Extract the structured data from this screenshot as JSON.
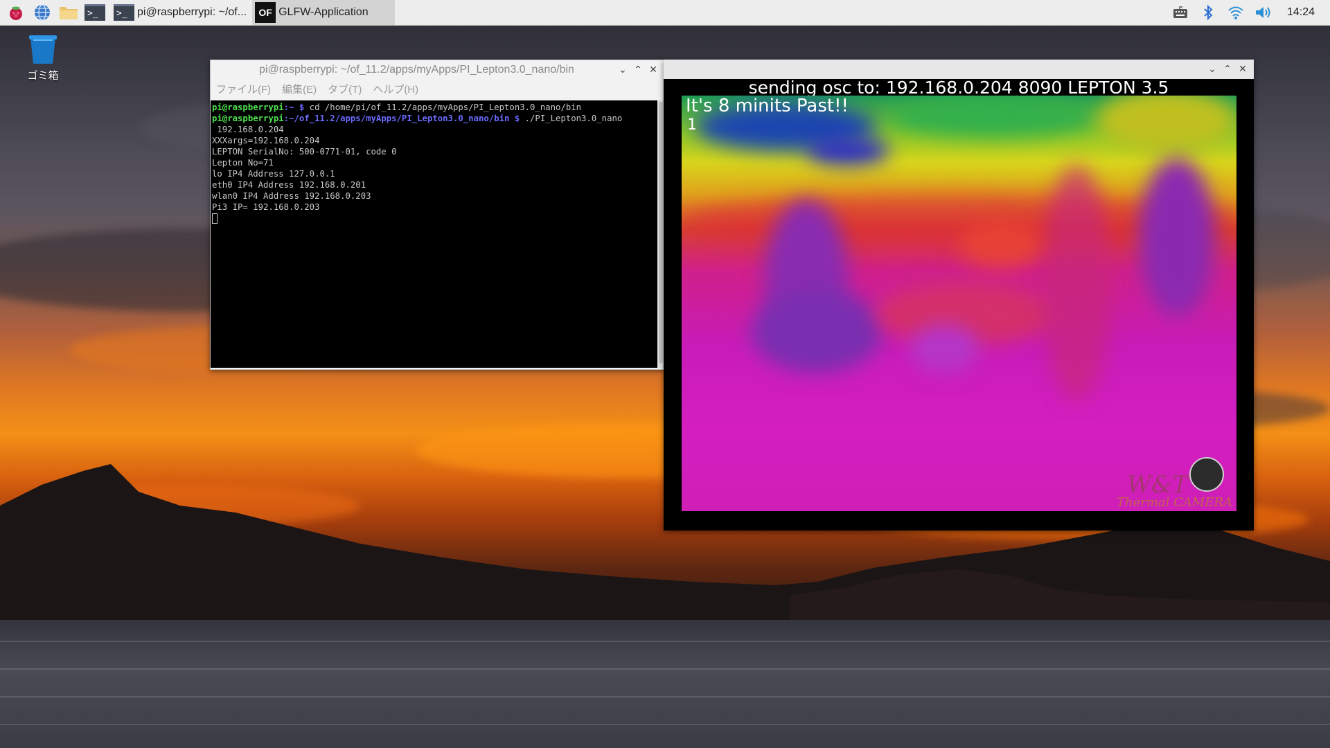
{
  "taskbar": {
    "launchers": [
      "raspberry-menu-icon",
      "web-browser-icon",
      "file-manager-icon",
      "terminal-icon"
    ],
    "tasks": [
      {
        "label": "pi@raspberrypi: ~/of..."
      },
      {
        "label": "GLFW-Application"
      }
    ],
    "of_logo": "OF",
    "clock": "14:24"
  },
  "desktop": {
    "trash_label": "ゴミ箱"
  },
  "terminal": {
    "title": "pi@raspberrypi: ~/of_11.2/apps/myApps/PI_Lepton3.0_nano/bin",
    "menus": [
      "ファイル(F)",
      "編集(E)",
      "タブ(T)",
      "ヘルプ(H)"
    ],
    "prompt_user": "pi@raspberrypi",
    "line1_path": ":~ $",
    "line1_cmd": " cd /home/pi/of_11.2/apps/myApps/PI_Lepton3.0_nano/bin",
    "line2_path": ":~/of_11.2/apps/myApps/PI_Lepton3.0_nano/bin $",
    "line2_cmd": " ./PI_Lepton3.0_nano",
    "output": [
      " 192.168.0.204",
      "XXXargs=192.168.0.204",
      "LEPTON SerialNo: 500-0771-01, code 0",
      "Lepton No=71",
      "lo IP4 Address 127.0.0.1",
      "eth0 IP4 Address 192.168.0.201",
      "wlan0 IP4 Address 192.168.0.203",
      "Pi3 IP= 192.168.0.203"
    ]
  },
  "glfw": {
    "osc_status": "sending osc to: 192.168.0.204 8090 LEPTON 3.5",
    "overlay_text": "It's 8 minits Past!!",
    "frame_counter": "1",
    "watermark_main": "W&T",
    "watermark_sub": "Thermal CAMERA"
  }
}
